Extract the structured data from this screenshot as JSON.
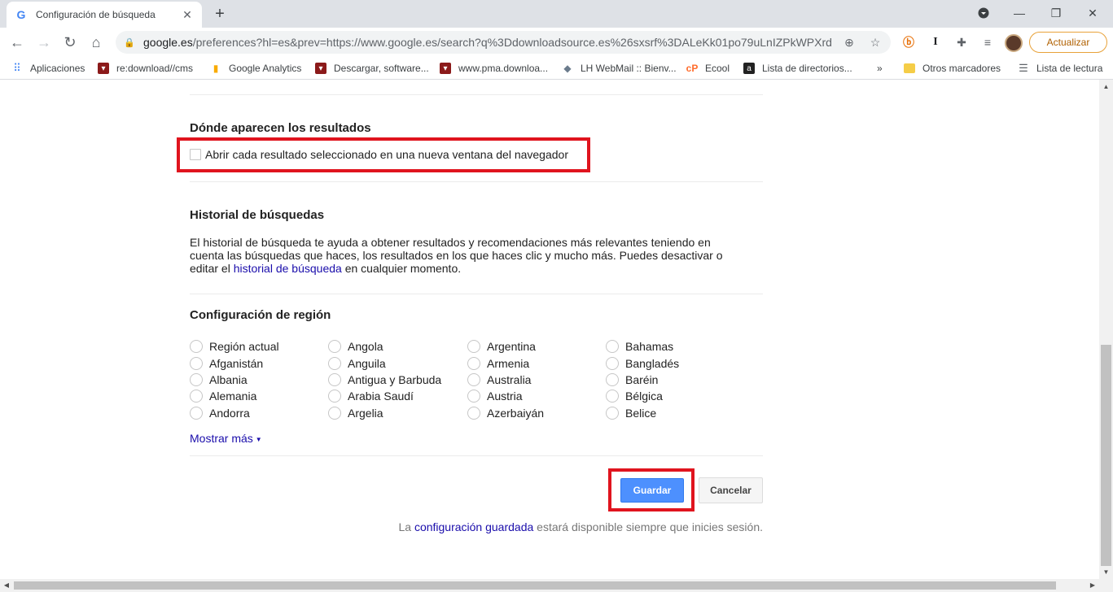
{
  "browser": {
    "tab_title": "Configuración de búsqueda",
    "url_host": "google.es",
    "url_rest": "/preferences?hl=es&prev=https://www.google.es/search?q%3Ddownloadsource.es%26sxsrf%3DALeKk01po79uLnIZPkWPXrd...",
    "update_label": "Actualizar",
    "bookmarks": [
      {
        "label": "Aplicaciones",
        "icon": "apps-grid-icon"
      },
      {
        "label": "re:download//cms",
        "icon": "download-site-icon"
      },
      {
        "label": "Google Analytics",
        "icon": "analytics-icon"
      },
      {
        "label": "Descargar, software...",
        "icon": "download-site-icon"
      },
      {
        "label": "www.pma.downloa...",
        "icon": "download-site-icon"
      },
      {
        "label": "LH WebMail :: Bienv...",
        "icon": "webmail-icon"
      },
      {
        "label": "Ecool",
        "icon": "cpanel-icon"
      },
      {
        "label": "Lista de directorios...",
        "icon": "amazon-icon"
      }
    ],
    "overflow": "»",
    "other_bookmarks": "Otros marcadores",
    "reading_list": "Lista de lectura"
  },
  "results_section": {
    "title": "Dónde aparecen los resultados",
    "checkbox_label": "Abrir cada resultado seleccionado en una nueva ventana del navegador"
  },
  "history_section": {
    "title": "Historial de búsquedas",
    "text_before": "El historial de búsqueda te ayuda a obtener resultados y recomendaciones más relevantes teniendo en cuenta las búsquedas que haces, los resultados en los que haces clic y mucho más. Puedes desactivar o editar el ",
    "link": "historial de búsqueda",
    "text_after": " en cualquier momento."
  },
  "region_section": {
    "title": "Configuración de región",
    "columns": [
      [
        "Región actual",
        "Afganistán",
        "Albania",
        "Alemania",
        "Andorra"
      ],
      [
        "Angola",
        "Anguila",
        "Antigua y Barbuda",
        "Arabia Saudí",
        "Argelia"
      ],
      [
        "Argentina",
        "Armenia",
        "Australia",
        "Austria",
        "Azerbaiyán"
      ],
      [
        "Bahamas",
        "Bangladés",
        "Baréin",
        "Bélgica",
        "Belice"
      ]
    ],
    "show_more": "Mostrar más"
  },
  "actions": {
    "save": "Guardar",
    "cancel": "Cancelar"
  },
  "footer": {
    "before": "La ",
    "link": "configuración guardada",
    "after": " estará disponible siempre que inicies sesión."
  },
  "colors": {
    "highlight": "#e0141e",
    "link": "#1a0dab",
    "primary_button": "#4d90fe"
  }
}
